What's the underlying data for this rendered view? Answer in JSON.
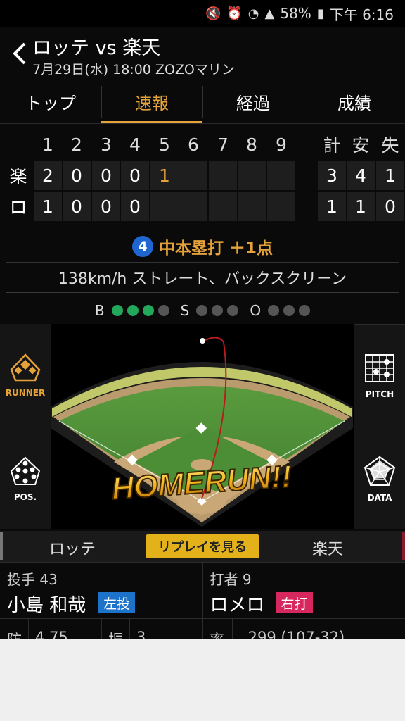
{
  "status_bar": {
    "battery": "58%",
    "time": "下午 6:16"
  },
  "header": {
    "title": "ロッテ vs 楽天",
    "subtitle": "7月29日(水) 18:00 ZOZOマリン"
  },
  "tabs": [
    "トップ",
    "速報",
    "経過",
    "成績"
  ],
  "active_tab": "速報",
  "scoreboard": {
    "innings": [
      "1",
      "2",
      "3",
      "4",
      "5",
      "6",
      "7",
      "8",
      "9"
    ],
    "totals_headers": [
      "計",
      "安",
      "失"
    ],
    "teams": [
      {
        "abbr": "楽",
        "runs": [
          "2",
          "0",
          "0",
          "0",
          "1",
          "",
          "",
          "",
          ""
        ],
        "totals": [
          "3",
          "4",
          "1"
        ]
      },
      {
        "abbr": "ロ",
        "runs": [
          "1",
          "0",
          "0",
          "0",
          "",
          "",
          "",
          "",
          ""
        ],
        "totals": [
          "1",
          "1",
          "0"
        ]
      }
    ]
  },
  "play": {
    "badge": "4",
    "result": "中本塁打 ＋1点",
    "detail": "138km/h ストレート、バックスクリーン"
  },
  "count": {
    "b_label": "B",
    "s_label": "S",
    "o_label": "O",
    "balls": 3,
    "strikes": 0,
    "outs": 0
  },
  "field": {
    "banner": "HOMERUN!!"
  },
  "side_buttons": {
    "runner": "RUNNER",
    "pitch": "PITCH",
    "pos": "POS.",
    "data": "DATA"
  },
  "team_bar": {
    "left": "ロッテ",
    "replay": "リプレイを見る",
    "right": "楽天"
  },
  "pitcher": {
    "role": "投手 43",
    "name": "小島 和哉",
    "tag": "左投"
  },
  "batter": {
    "role": "打者 9",
    "name": "ロメロ",
    "tag": "右打"
  },
  "stats": {
    "era_label": "防",
    "era": "4.75",
    "k_label": "振",
    "k": "3",
    "avg_label": "率",
    "avg": ".299 (107-32)"
  },
  "colors": {
    "accent": "#e5a23a",
    "ball_on": "#23a75a",
    "badge": "#1f66d0"
  }
}
